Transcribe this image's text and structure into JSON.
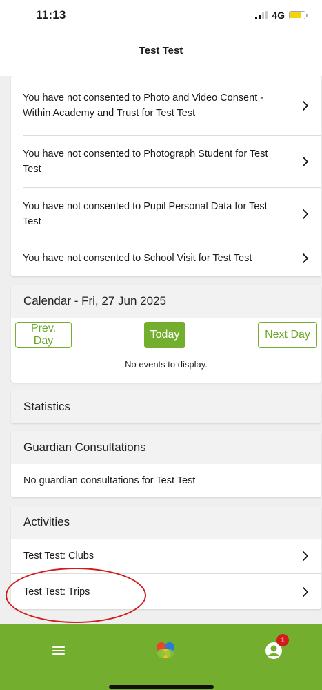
{
  "status_bar": {
    "time": "11:13",
    "network": "4G",
    "battery_level": 0.8
  },
  "header": {
    "title": "Test Test"
  },
  "consents": [
    {
      "text": "You have not consented to Photo and Video Consent - Within Academy and Trust for Test Test"
    },
    {
      "text": "You have not consented to Photograph Student for Test Test"
    },
    {
      "text": "You have not consented to Pupil Personal Data for Test Test"
    },
    {
      "text": "You have not consented to School Visit for Test Test"
    }
  ],
  "calendar": {
    "title": "Calendar - Fri, 27 Jun 2025",
    "prev_label": "Prev. Day",
    "today_label": "Today",
    "next_label": "Next Day",
    "empty_message": "No events to display."
  },
  "statistics": {
    "title": "Statistics"
  },
  "guardian": {
    "title": "Guardian Consultations",
    "empty_message": "No guardian consultations for Test Test"
  },
  "activities": {
    "title": "Activities",
    "items": [
      {
        "label": "Test Test: Clubs"
      },
      {
        "label": "Test Test: Trips"
      }
    ]
  },
  "tab_bar": {
    "menu_icon": "menu-icon",
    "home_icon": "app-logo-icon",
    "profile_icon": "profile-icon",
    "profile_badge": "1"
  },
  "colors": {
    "accent": "#74ae2f",
    "annotation": "#d21c1c",
    "badge": "#d21c1c"
  }
}
